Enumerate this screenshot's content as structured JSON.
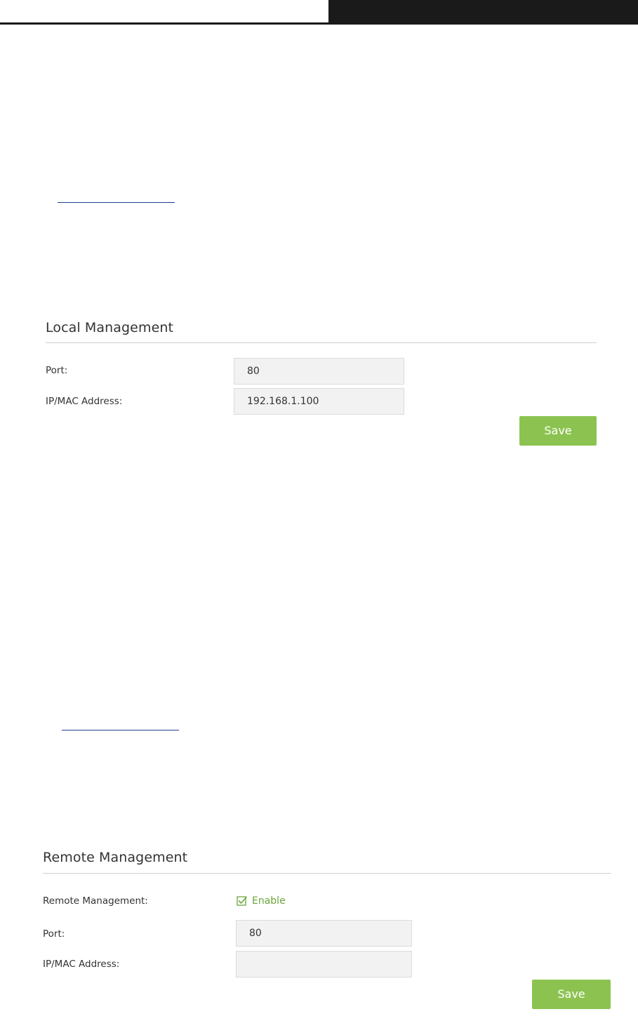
{
  "local_management": {
    "title": "Local Management",
    "port_label": "Port:",
    "port_value": "80",
    "ipmac_label": "IP/MAC Address:",
    "ipmac_value": "192.168.1.100",
    "save_label": "Save"
  },
  "remote_management": {
    "title": "Remote Management",
    "remote_label": "Remote Management:",
    "enable_label": "Enable",
    "enabled": true,
    "port_label": "Port:",
    "port_value": "80",
    "ipmac_label": "IP/MAC Address:",
    "ipmac_value": "",
    "save_label": "Save"
  },
  "colors": {
    "accent_green": "#8cc350",
    "checkbox_green": "#6aa63c",
    "header_dark": "#1a1a1a",
    "link_blue": "#1f3f8f"
  }
}
